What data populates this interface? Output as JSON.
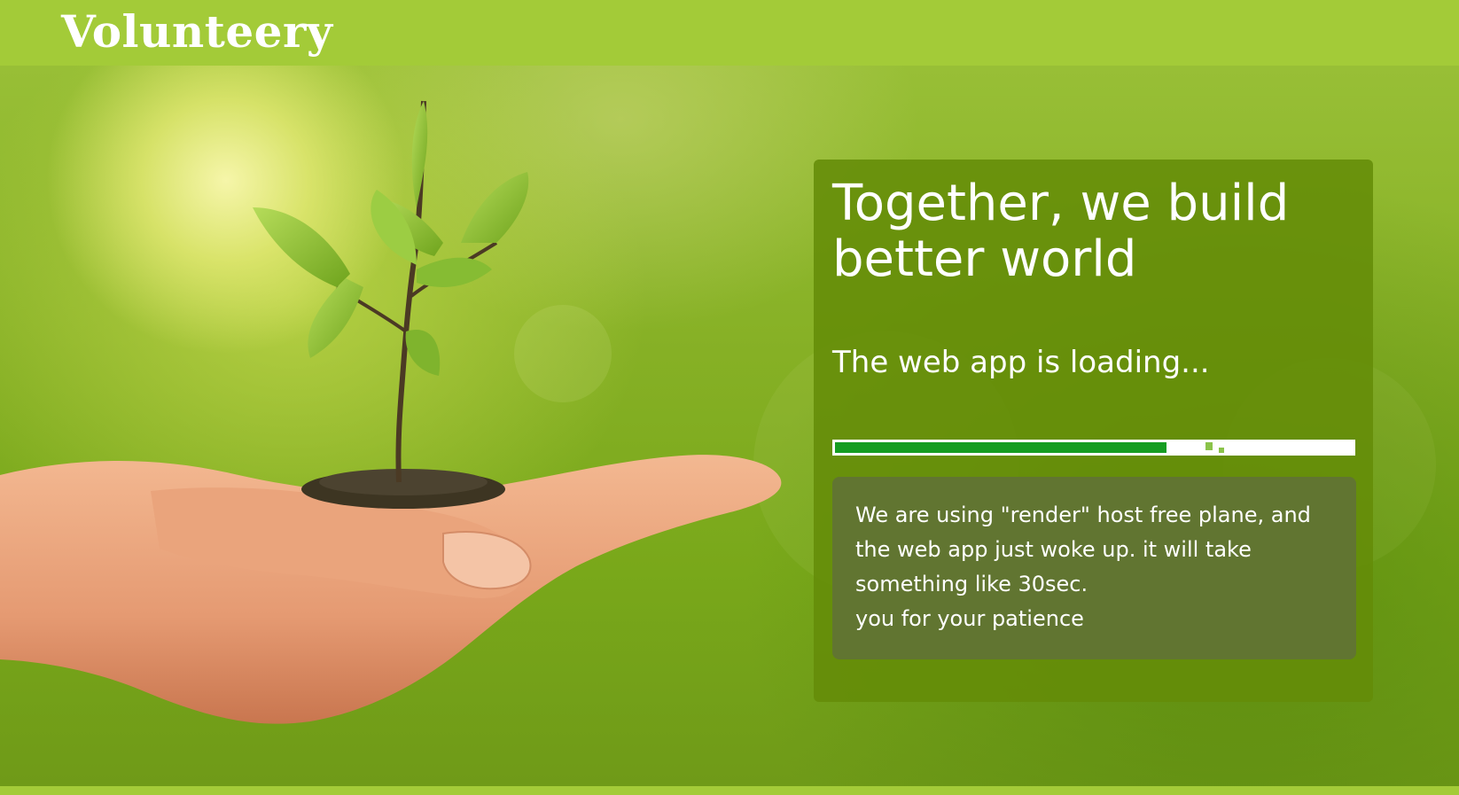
{
  "header": {
    "logo_text": "Volunteery",
    "background_color": "#a3cb38"
  },
  "hero": {
    "illustration": "hand-holding-seedling"
  },
  "card": {
    "title": "Together, we build better world",
    "loading_text": "The web app is loading...",
    "progress": {
      "value_percent": 64,
      "fill_color": "#169d22"
    },
    "notice_lines": [
      "We are using \"render\" host free plane, and",
      "the web app just woke up. it will take",
      "something like 30sec.",
      "you for your patience"
    ]
  }
}
